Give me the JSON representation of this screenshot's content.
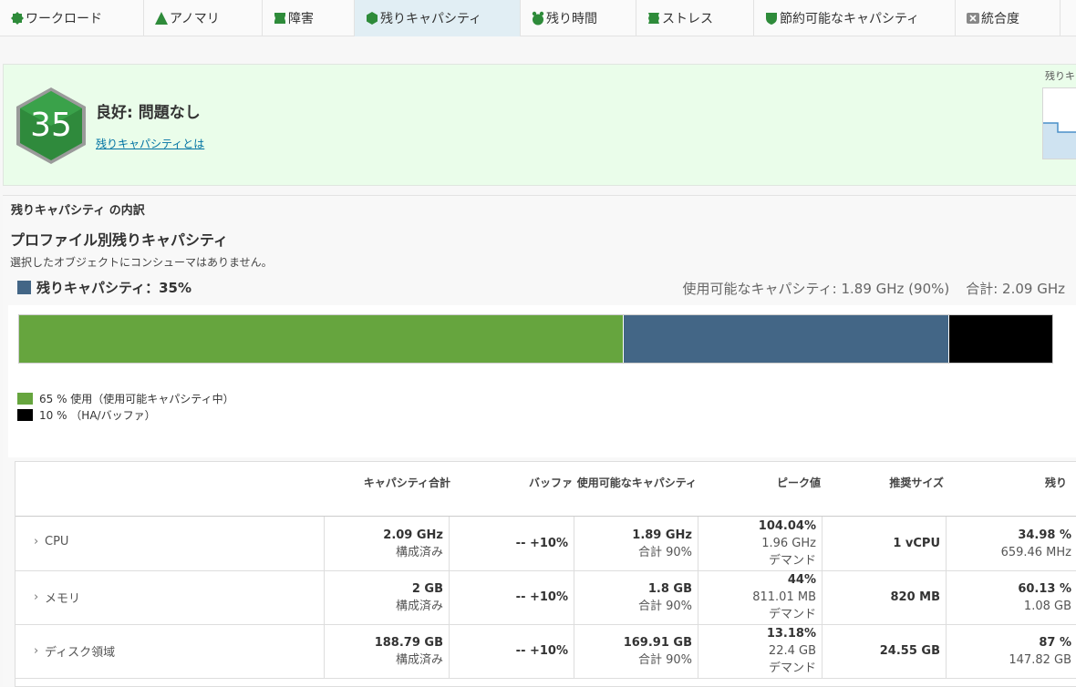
{
  "tabs": [
    {
      "label": "ワークロード",
      "icon": "workload-icon",
      "active": false
    },
    {
      "label": "アノマリ",
      "icon": "anomaly-icon",
      "active": false
    },
    {
      "label": "障害",
      "icon": "fault-icon",
      "active": false
    },
    {
      "label": "残りキャパシティ",
      "icon": "capacity-remaining-icon",
      "active": true
    },
    {
      "label": "残り時間",
      "icon": "time-remaining-icon",
      "active": false
    },
    {
      "label": "ストレス",
      "icon": "stress-icon",
      "active": false
    },
    {
      "label": "節約可能なキャパシティ",
      "icon": "reclaimable-icon",
      "active": false
    },
    {
      "label": "統合度",
      "icon": "density-icon",
      "active": false
    }
  ],
  "status": {
    "score": "35",
    "title": "良好: 問題なし",
    "link": "残りキャパシティとは",
    "mini_chart_label": "残りキ"
  },
  "breakdown": {
    "section_title": "残りキャパシティ の内訳",
    "profile_title": "プロファイル別残りキャパシティ",
    "no_consumer": "選択したオブジェクトにコンシューマはありません。",
    "remaining_label": "残りキャパシティ：35%",
    "usable_text": "使用可能なキャパシティ: 1.89 GHz (90%)",
    "total_text": "合計: 2.09 GHz"
  },
  "chart_data": {
    "type": "bar",
    "segments": [
      {
        "name": "65 % 使用（使用可能キャパシティ中）",
        "value": 58.5,
        "color": "#66a53e"
      },
      {
        "name": "残りキャパシティ",
        "value": 31.5,
        "color": "#436686"
      },
      {
        "name": "10 % （HA/バッファ）",
        "value": 10,
        "color": "#000000"
      }
    ],
    "legend": [
      {
        "label": "65 % 使用（使用可能キャパシティ中）",
        "color": "#66a53e"
      },
      {
        "label": "10 % （HA/バッファ）",
        "color": "#000000"
      }
    ]
  },
  "table": {
    "headers": [
      "キャパシティ合計",
      "バッファ",
      "使用可能なキャパシティ",
      "ピーク値",
      "推奨サイズ",
      "残り"
    ],
    "rows": [
      {
        "name": "CPU",
        "total": "2.09 GHz",
        "total_sub": "構成済み",
        "buffer": "-- +10%",
        "usable": "1.89 GHz",
        "usable_sub": "合計 90%",
        "peak": "104.04%",
        "peak_sub": "1.96 GHz",
        "peak_sub2": "デマンド",
        "recommended": "1 vCPU",
        "remaining": "34.98 %",
        "remaining_sub": "659.46 MHz"
      },
      {
        "name": "メモリ",
        "total": "2 GB",
        "total_sub": "構成済み",
        "buffer": "-- +10%",
        "usable": "1.8 GB",
        "usable_sub": "合計 90%",
        "peak": "44%",
        "peak_sub": "811.01 MB",
        "peak_sub2": "デマンド",
        "recommended": "820 MB",
        "remaining": "60.13 %",
        "remaining_sub": "1.08 GB"
      },
      {
        "name": "ディスク領域",
        "total": "188.79 GB",
        "total_sub": "構成済み",
        "buffer": "-- +10%",
        "usable": "169.91 GB",
        "usable_sub": "合計 90%",
        "peak": "13.18%",
        "peak_sub": "22.4 GB",
        "peak_sub2": "デマンド",
        "recommended": "24.55 GB",
        "remaining": "87 %",
        "remaining_sub": "147.82 GB"
      }
    ]
  }
}
